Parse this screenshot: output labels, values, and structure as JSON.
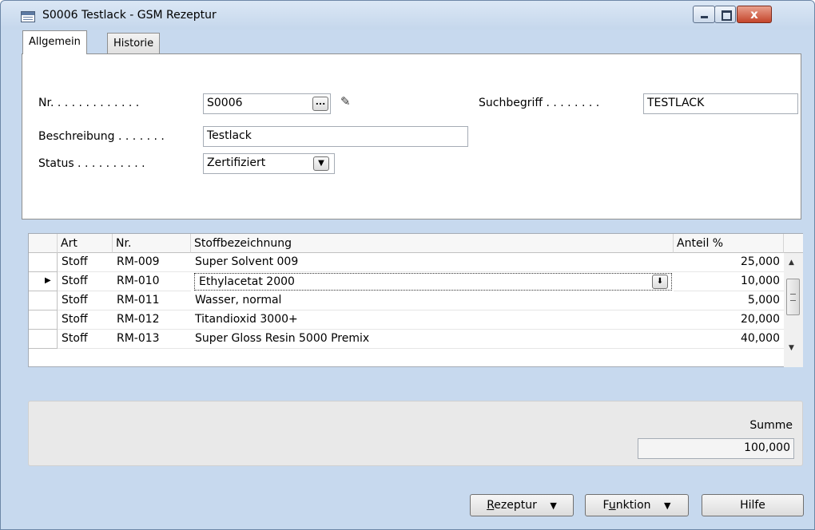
{
  "window": {
    "title": "S0006 Testlack - GSM Rezeptur",
    "close_glyph": "x"
  },
  "tabs": [
    {
      "label": "Allgemein",
      "active": true
    },
    {
      "label": "Historie",
      "active": false
    }
  ],
  "form": {
    "nr_label": "Nr. . . . . . . . . . . . .",
    "nr_value": "S0006",
    "beschreibung_label": "Beschreibung . . . . . . .",
    "beschreibung_value": "Testlack",
    "status_label": "Status . . . . . . . . . .",
    "status_value": "Zertifiziert",
    "suchbegriff_label": "Suchbegriff . . . . . . . .",
    "suchbegriff_value": "TESTLACK",
    "lookup_button_label": "..."
  },
  "grid": {
    "columns": [
      "Art",
      "Nr.",
      "Stoffbezeichnung",
      "Anteil %"
    ],
    "rows": [
      {
        "art": "Stoff",
        "nr": "RM-009",
        "name": "Super Solvent 009",
        "anteil": "25,000"
      },
      {
        "art": "Stoff",
        "nr": "RM-010",
        "name": "Ethylacetat 2000",
        "anteil": "10,000"
      },
      {
        "art": "Stoff",
        "nr": "RM-011",
        "name": "Wasser, normal",
        "anteil": "5,000"
      },
      {
        "art": "Stoff",
        "nr": "RM-012",
        "name": "Titandioxid 3000+",
        "anteil": "20,000"
      },
      {
        "art": "Stoff",
        "nr": "RM-013",
        "name": "Super Gloss Resin 5000 Premix",
        "anteil": "40,000"
      }
    ],
    "current_row": 1
  },
  "summary": {
    "label": "Summe",
    "value": "100,000"
  },
  "buttons": {
    "rezeptur_first": "R",
    "rezeptur_rest": "ezeptur",
    "funktion_first": "F",
    "funktion_u": "u",
    "funktion_rest": "nktion",
    "hilfe": "Hilfe"
  },
  "icons": {
    "title": "form-window-icon",
    "edit": "pencil-icon",
    "dropdown": "dropdown-arrow-icon",
    "row_pointer": "row-pointer-icon"
  }
}
